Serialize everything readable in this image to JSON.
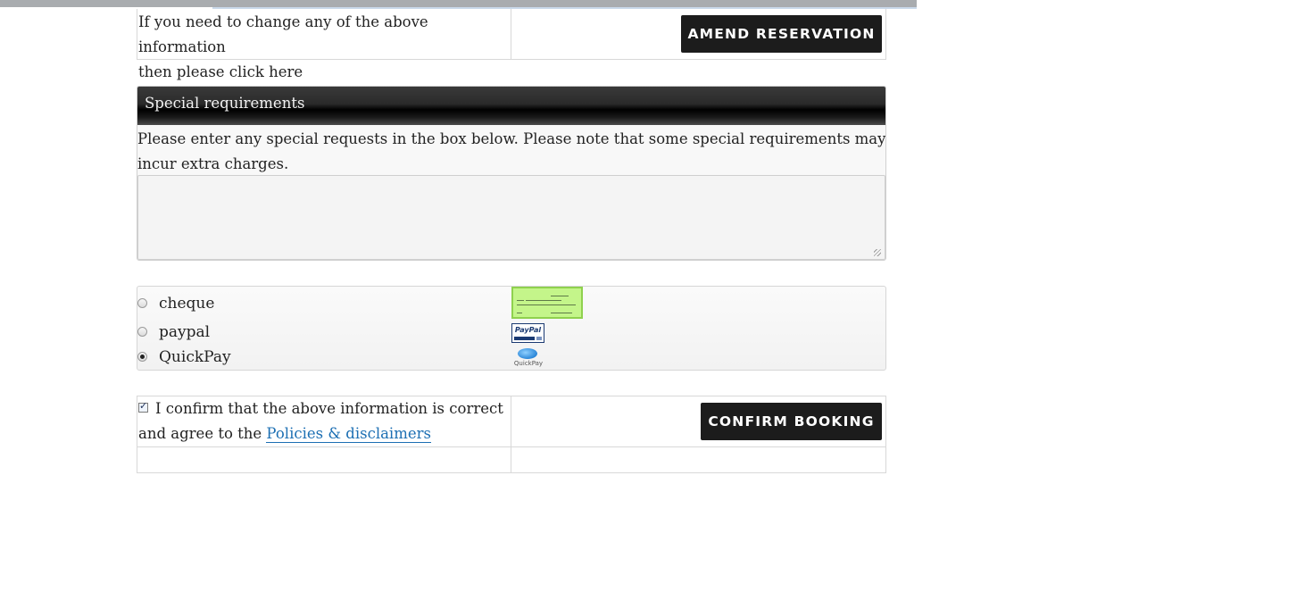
{
  "amend": {
    "info_line1": "If you need to change any of the above information",
    "info_line2": "then please click here",
    "button_label": "AMEND RESERVATION"
  },
  "special_requirements": {
    "title": "Special requirements",
    "description": "Please enter any special requests in the box below. Please note that some special requirements may incur extra charges.",
    "textarea_value": ""
  },
  "payment": {
    "options": [
      {
        "label": "cheque",
        "selected": false,
        "icon": "cheque-icon"
      },
      {
        "label": "paypal",
        "selected": false,
        "icon": "paypal-icon"
      },
      {
        "label": "QuickPay",
        "selected": true,
        "icon": "quickpay-icon"
      }
    ],
    "paypal_logo_text": "PayPal",
    "quickpay_logo_text": "QuickPay"
  },
  "confirm": {
    "checkbox_checked": true,
    "text_before_link": "I confirm that the above information is correct and agree to the ",
    "link_text": "Policies & disclaimers",
    "button_label": "CONFIRM BOOKING"
  },
  "colors": {
    "button_bg": "#1c1c1c",
    "header_bg": "#2a2a2a",
    "link": "#1c6fb3",
    "cheque_green": "#c4f58a"
  }
}
